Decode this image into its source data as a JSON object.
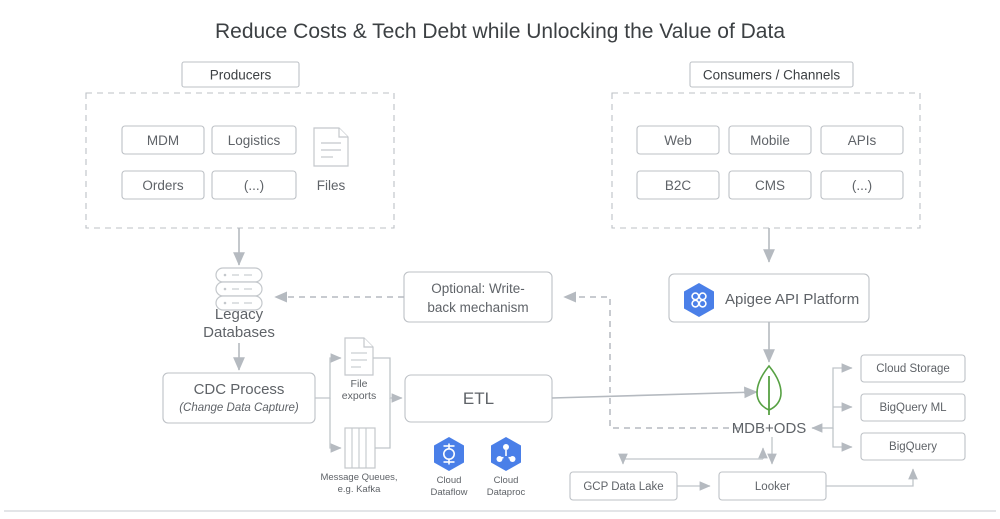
{
  "title": "Reduce Costs & Tech Debt while Unlocking the Value of Data",
  "colors": {
    "accent_blue": "#4a7fe8",
    "mongodb_green": "#57a143",
    "border_gray": "#bdc1c6",
    "text_gray": "#5f6368",
    "connector_gray": "#b5bac0"
  },
  "producers": {
    "group_label": "Producers",
    "items": [
      {
        "label": "MDM"
      },
      {
        "label": "Logistics"
      },
      {
        "label": "Orders"
      },
      {
        "label": "(...)"
      }
    ],
    "files": {
      "label": "Files",
      "icon": "document-icon"
    }
  },
  "consumers": {
    "group_label": "Consumers / Channels",
    "items": [
      {
        "label": "Web"
      },
      {
        "label": "Mobile"
      },
      {
        "label": "APIs"
      },
      {
        "label": "B2C"
      },
      {
        "label": "CMS"
      },
      {
        "label": "(...)"
      }
    ]
  },
  "nodes": {
    "legacy_databases": {
      "line1": "Legacy",
      "line2": "Databases",
      "icon": "database-stack-icon"
    },
    "cdc_process": {
      "title": "CDC Process",
      "subtitle": "(Change Data Capture)"
    },
    "file_exports": {
      "line1": "File",
      "line2": "exports",
      "icon": "document-icon"
    },
    "message_queues": {
      "line1": "Message Queues,",
      "line2": "e.g. Kafka",
      "icon": "queue-icon"
    },
    "etl": {
      "label": "ETL"
    },
    "write_back": {
      "line1": "Optional: Write-",
      "line2": "back mechanism"
    },
    "apigee": {
      "label": "Apigee API Platform",
      "icon": "apigee-hexagon-icon"
    },
    "mdb_ods": {
      "label": "MDB+ODS",
      "icon": "mongodb-leaf-icon"
    },
    "cloud_storage": {
      "label": "Cloud Storage"
    },
    "bigquery_ml": {
      "label": "BigQuery ML"
    },
    "bigquery": {
      "label": "BigQuery"
    },
    "gcp_data_lake": {
      "label": "GCP Data Lake"
    },
    "looker": {
      "label": "Looker"
    }
  },
  "gcp_services": [
    {
      "line1": "Cloud",
      "line2": "Dataflow",
      "icon": "cloud-dataflow-hexagon-icon"
    },
    {
      "line1": "Cloud",
      "line2": "Dataproc",
      "icon": "cloud-dataproc-hexagon-icon"
    }
  ]
}
